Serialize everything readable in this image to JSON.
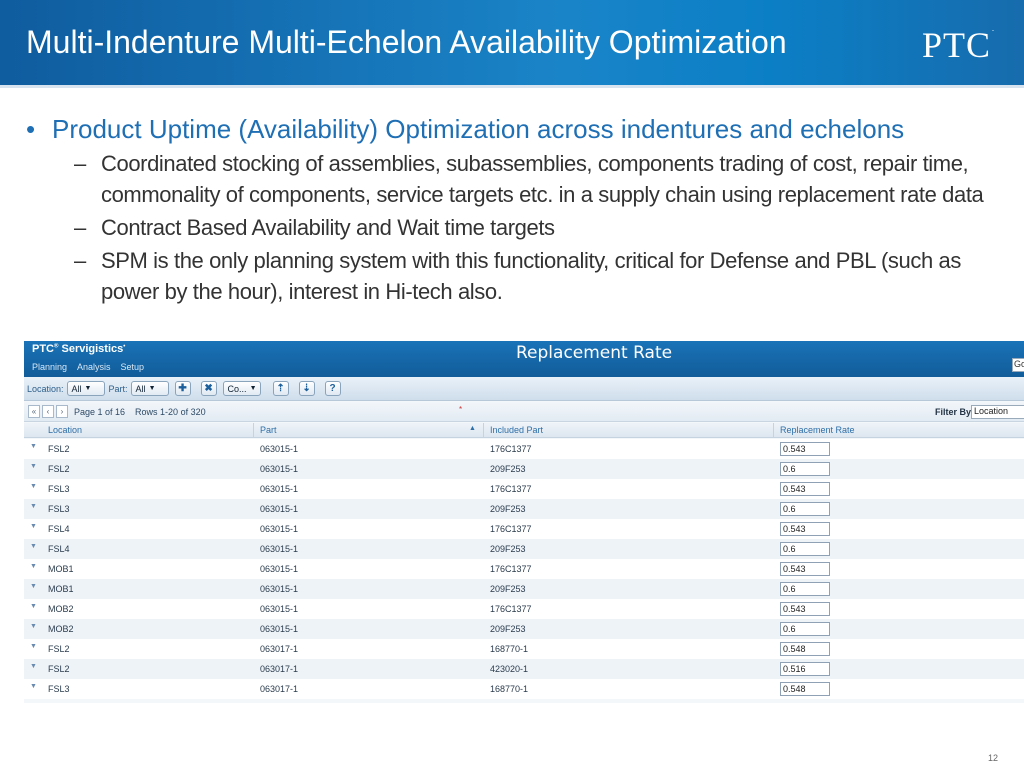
{
  "slide": {
    "title": "Multi-Indenture Multi-Echelon Availability Optimization",
    "logo": "PTC",
    "page_number": "12",
    "bullet_main": "Product Uptime (Availability) Optimization across indentures and echelons",
    "sub_bullets": [
      "Coordinated stocking of assemblies, subassemblies, components trading of cost, repair time, commonality of components, service targets etc. in a supply chain using replacement rate data",
      "Contract Based Availability and Wait time targets",
      "SPM is the only planning system with this functionality, critical for Defense and PBL (such as power by the hour), interest in Hi-tech also."
    ]
  },
  "app": {
    "brand": "PTC",
    "brand_suffix": "Servigistics",
    "menu": [
      "Planning",
      "Analysis",
      "Setup"
    ],
    "title": "Replacement Rate",
    "top_right_input": "Go",
    "toolbar": {
      "location_label": "Location:",
      "location_value": "All",
      "part_label": "Part:",
      "part_value": "All",
      "column_combo": "Co...",
      "add_icon": "plus-icon",
      "delete_icon": "x-icon"
    },
    "pager": {
      "page_info": "Page 1 of 16",
      "rows_info": "Rows 1-20 of 320",
      "filter_label": "Filter By",
      "filter_value": "Location"
    },
    "columns": [
      "Location",
      "Part",
      "Included Part",
      "Replacement Rate"
    ],
    "rows": [
      {
        "location": "FSL2",
        "part": "063015-1",
        "included_part": "176C1377",
        "rate": "0.543"
      },
      {
        "location": "FSL2",
        "part": "063015-1",
        "included_part": "209F253",
        "rate": "0.6"
      },
      {
        "location": "FSL3",
        "part": "063015-1",
        "included_part": "176C1377",
        "rate": "0.543"
      },
      {
        "location": "FSL3",
        "part": "063015-1",
        "included_part": "209F253",
        "rate": "0.6"
      },
      {
        "location": "FSL4",
        "part": "063015-1",
        "included_part": "176C1377",
        "rate": "0.543"
      },
      {
        "location": "FSL4",
        "part": "063015-1",
        "included_part": "209F253",
        "rate": "0.6"
      },
      {
        "location": "MOB1",
        "part": "063015-1",
        "included_part": "176C1377",
        "rate": "0.543"
      },
      {
        "location": "MOB1",
        "part": "063015-1",
        "included_part": "209F253",
        "rate": "0.6"
      },
      {
        "location": "MOB2",
        "part": "063015-1",
        "included_part": "176C1377",
        "rate": "0.543"
      },
      {
        "location": "MOB2",
        "part": "063015-1",
        "included_part": "209F253",
        "rate": "0.6"
      },
      {
        "location": "FSL2",
        "part": "063017-1",
        "included_part": "168770-1",
        "rate": "0.548"
      },
      {
        "location": "FSL2",
        "part": "063017-1",
        "included_part": "423020-1",
        "rate": "0.516"
      },
      {
        "location": "FSL3",
        "part": "063017-1",
        "included_part": "168770-1",
        "rate": "0.548"
      }
    ]
  }
}
